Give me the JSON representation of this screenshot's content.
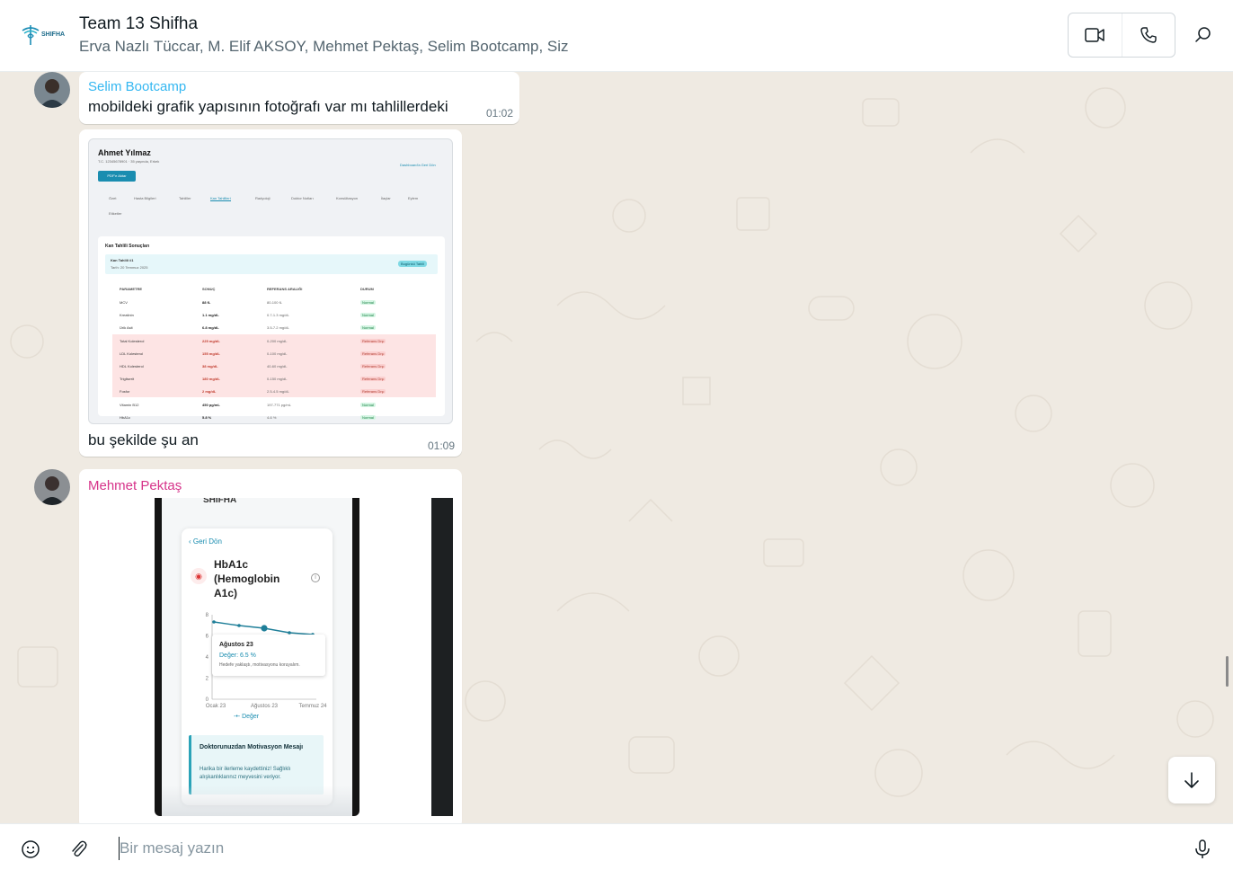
{
  "header": {
    "logo_text": "SHIFHA",
    "title": "Team 13 Shifha",
    "members": "Erva Nazlı Tüccar, M. Elif AKSOY, Mehmet Pektaş, Selim Bootcamp, Siz",
    "video_icon": "video-camera-icon",
    "call_icon": "phone-icon",
    "search_icon": "search-icon"
  },
  "messages": [
    {
      "sender": "Selim Bootcamp",
      "sender_color": "#34b7f1",
      "text": "mobildeki grafik yapısının fotoğrafı var mı tahlillerdeki",
      "time": "01:02"
    },
    {
      "sender": "Selim Bootcamp",
      "image": {
        "patient_name": "Ahmet Yılmaz",
        "patient_info": "T.C. 12345678901 · 35 yaşında, Erkek",
        "export_button": "PDF'e Aktar",
        "back_link": "Dashboard'a Geri Dön",
        "tabs": [
          "Özet",
          "Hasta Bilgileri",
          "Tahliller",
          "Kan Tahlilleri",
          "Radyoloji",
          "Doktor Notları",
          "Konsültasyon",
          "İlaçlar",
          "Eylem",
          "Etiketler"
        ],
        "section_title": "Kan Tahlili Sonuçları",
        "test_name": "Kan Tahlili #1",
        "test_date": "Tarih: 20 Temmuz 2025",
        "test_badge": "Bugünkü Tahlil",
        "columns": [
          "PARAMETRE",
          "SONUÇ",
          "REFERANS ARALIĞI",
          "DURUM"
        ],
        "rows": [
          {
            "param": "MCV",
            "result": "88 fL",
            "range": "80-100 fL",
            "status": "Normal",
            "abnormal": false
          },
          {
            "param": "Kreatinin",
            "result": "1.1 mg/dL",
            "range": "0.7-1.3 mg/dL",
            "status": "Normal",
            "abnormal": false
          },
          {
            "param": "Ürik Asit",
            "result": "6.8 mg/dL",
            "range": "3.5-7.2 mg/dL",
            "status": "Normal",
            "abnormal": false
          },
          {
            "param": "Total Kolesterol",
            "result": "225 mg/dL",
            "range": "0-200 mg/dL",
            "status": "Referans Dışı",
            "abnormal": true
          },
          {
            "param": "LDL Kolesterol",
            "result": "155 mg/dL",
            "range": "0-100 mg/dL",
            "status": "Referans Dışı",
            "abnormal": true
          },
          {
            "param": "HDL Kolesterol",
            "result": "38 mg/dL",
            "range": "40-60 mg/dL",
            "status": "Referans Dışı",
            "abnormal": true
          },
          {
            "param": "Trigliserit",
            "result": "180 mg/dL",
            "range": "0-150 mg/dL",
            "status": "Referans Dışı",
            "abnormal": true
          },
          {
            "param": "Fosfor",
            "result": "2 mg/dL",
            "range": "2.5-4.5 mg/dL",
            "status": "Referans Dışı",
            "abnormal": true
          },
          {
            "param": "Vitamin B12",
            "result": "450 pg/mL",
            "range": "197-771 pg/mL",
            "status": "Normal",
            "abnormal": false
          },
          {
            "param": "HbA1c",
            "result": "5.8 %",
            "range": "4-6 %",
            "status": "Normal",
            "abnormal": false
          }
        ]
      },
      "text": "bu şekilde şu an",
      "time": "01:09"
    },
    {
      "sender": "Mehmet Pektaş",
      "sender_color": "#d6338a",
      "image": {
        "app_name": "SHIFHA",
        "back_label": "Geri Dön",
        "metric_title": "HbA1c (Hemoglobin A1c)",
        "tooltip_title": "Ağustos 23",
        "tooltip_value": "Değer: 6.5 %",
        "tooltip_note": "Hedefe yaklaştı, motivasyonu koruyalım.",
        "x_ticks": [
          "Ocak 23",
          "Ağustos 23",
          "Temmuz 24"
        ],
        "y_ticks": [
          "8",
          "6",
          "4",
          "2",
          "0"
        ],
        "legend": "Değer",
        "note_title": "Doktorunuzdan Motivasyon Mesajı",
        "note_text": "Harika bir ilerleme kaydettiniz! Sağlıklı alışkanlıklarınız meyvesini veriyor."
      }
    }
  ],
  "composer": {
    "placeholder": "Bir mesaj yazın",
    "emoji_icon": "emoji-icon",
    "attach_icon": "paperclip-icon",
    "mic_icon": "microphone-icon"
  },
  "scroll_down_icon": "arrow-down-icon"
}
